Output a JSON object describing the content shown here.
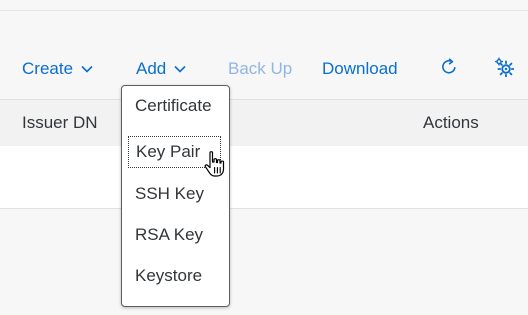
{
  "toolbar": {
    "create_label": "Create",
    "add_label": "Add",
    "backup_label": "Back Up",
    "download_label": "Download",
    "icons": [
      "chevron-down-icon",
      "refresh-icon",
      "settings-icon"
    ]
  },
  "table": {
    "columns": [
      "Issuer DN",
      "Actions"
    ]
  },
  "add_menu": {
    "items": [
      "Certificate",
      "Key Pair",
      "SSH Key",
      "RSA Key",
      "Keystore"
    ]
  },
  "colors": {
    "accent": "#0a6ed1",
    "disabled": "#8fb7e3",
    "text": "#32363a",
    "background": "#f7f7f7"
  }
}
